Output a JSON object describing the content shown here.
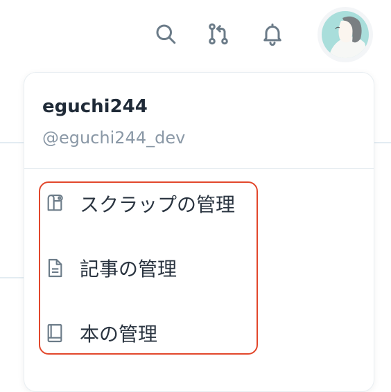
{
  "header": {
    "icons": [
      "search-icon",
      "pull-request-icon",
      "bell-icon"
    ],
    "avatar_icon": "user-avatar"
  },
  "menu": {
    "username": "eguchi244",
    "handle": "@eguchi244_dev",
    "items": [
      {
        "label": "スクラップの管理",
        "icon": "scrap-icon"
      },
      {
        "label": "記事の管理",
        "icon": "article-icon"
      },
      {
        "label": "本の管理",
        "icon": "book-icon"
      }
    ]
  },
  "colors": {
    "icon": "#6b7b88",
    "highlight": "#e2472b",
    "text": "#2a3440",
    "muted": "#8a98a6"
  }
}
